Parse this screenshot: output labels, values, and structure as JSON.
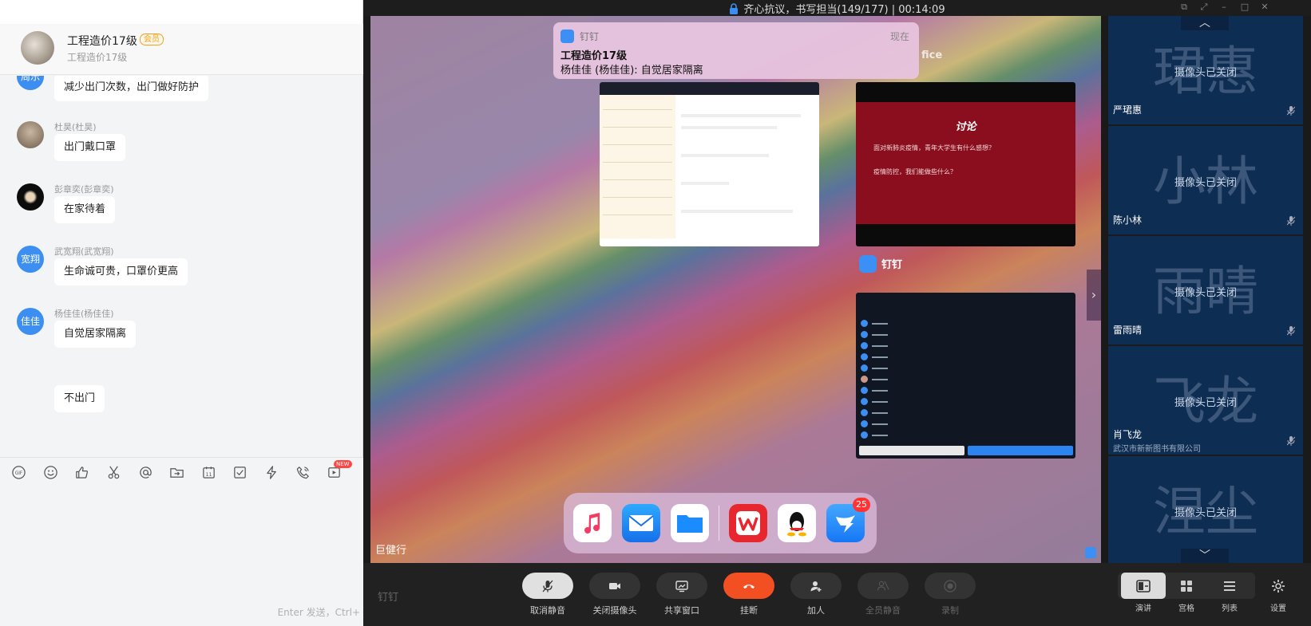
{
  "chat": {
    "group_name": "工程造价17级",
    "vip_label": "会员",
    "group_sub": "工程造价17级",
    "messages": [
      {
        "avatar_text": "周乐",
        "sender": "",
        "text": "减少出门次数，出门做好防护"
      },
      {
        "avatar_text": "",
        "sender": "杜昊(杜昊)",
        "text": "出门戴口罩"
      },
      {
        "avatar_text": "",
        "sender": "彭章奕(彭章奕)",
        "text": "在家待着"
      },
      {
        "avatar_text": "宽翔",
        "sender": "武宽翔(武宽翔)",
        "text": "生命诚可贵，口罩价更高"
      },
      {
        "avatar_text": "佳佳",
        "sender": "杨佳佳(杨佳佳)",
        "text": "自觉居家隔离"
      },
      {
        "avatar_text": "",
        "sender": "",
        "text": "不出门"
      }
    ],
    "toolbar": {
      "icons": [
        "gif-icon",
        "emoji-icon",
        "thumbs-up-icon",
        "scissors-icon",
        "at-icon",
        "folder-send-icon",
        "calendar-icon",
        "checkbox-icon",
        "lightning-icon",
        "phone-icon",
        "video-record-icon"
      ],
      "calendar_day": "11",
      "new_badge": "NEW"
    },
    "send_hint": "Enter 发送，Ctrl+"
  },
  "meeting": {
    "title": "齐心抗议，书写担当(149/177) | 00:14:09",
    "notification": {
      "app": "钉钉",
      "time": "现在",
      "title": "工程造价17级",
      "body": "杨佳佳 (杨佳佳): 自觉居家隔离"
    },
    "office_word": "fice",
    "slide": {
      "title": "讨论",
      "q1": "面对新肺炎疫情，青年大学生有什么感想？",
      "q2": "疫情防控，我们能做些什么？"
    },
    "dingtalk_label": "钉钉",
    "qq_badge": "25",
    "presenter": "巨健行",
    "participants": [
      {
        "big": "珺惠",
        "status": "摄像头已关闭",
        "name": "严珺惠",
        "org": ""
      },
      {
        "big": "小林",
        "status": "摄像头已关闭",
        "name": "陈小林",
        "org": ""
      },
      {
        "big": "雨晴",
        "status": "摄像头已关闭",
        "name": "雷雨晴",
        "org": ""
      },
      {
        "big": "飞龙",
        "status": "摄像头已关闭",
        "name": "肖飞龙",
        "org": "武汉市新新图书有限公司"
      },
      {
        "big": "涅尘",
        "status": "摄像头已关闭",
        "name": "",
        "org": ""
      }
    ],
    "watermark": "钉钉",
    "controls": {
      "unmute": "取消静音",
      "camera_off": "关闭摄像头",
      "share_window": "共享窗口",
      "hang_up": "挂断",
      "add_person": "加人",
      "mute_all": "全员静音",
      "record": "录制"
    },
    "layouts": {
      "presenter": "演讲",
      "grid": "宫格",
      "list": "列表",
      "settings": "设置"
    }
  }
}
